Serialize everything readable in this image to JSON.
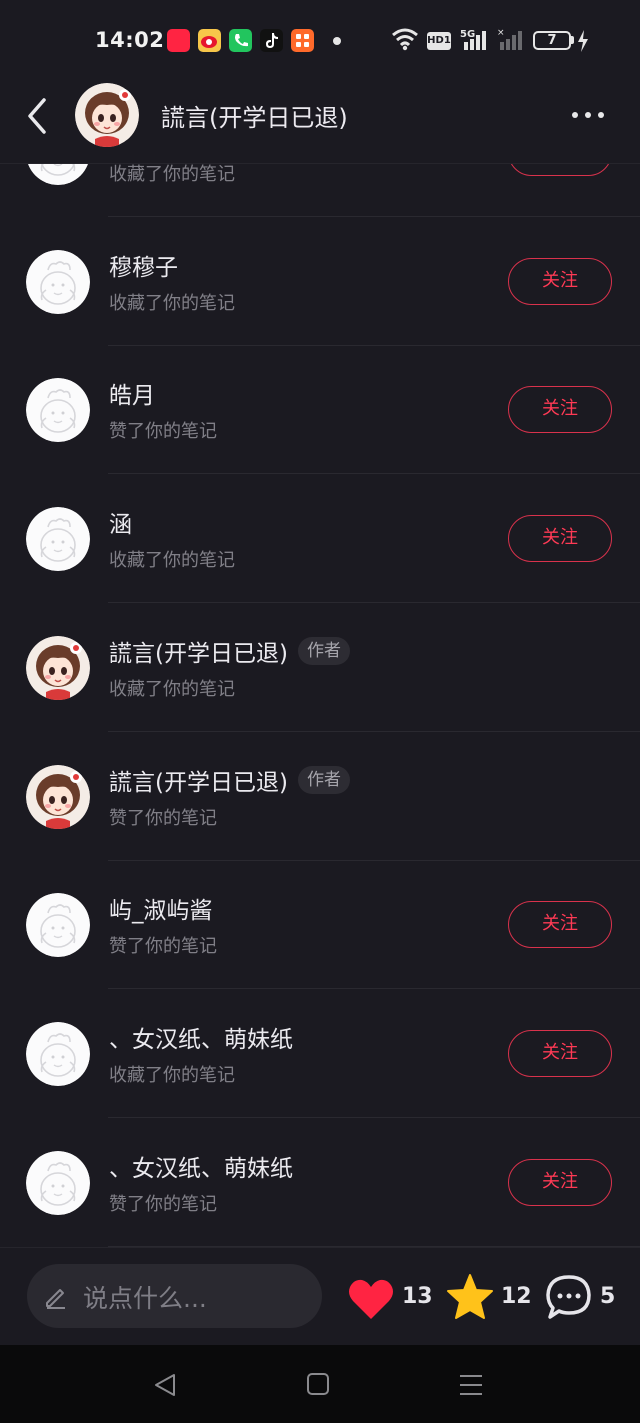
{
  "status_bar": {
    "time": "14:02",
    "hd_label": "HD1",
    "network": "5G",
    "battery": "7"
  },
  "header": {
    "title": "謊言(开学日已退)"
  },
  "notifications": [
    {
      "partial": true,
      "action": "收藏了你的笔记",
      "avatar": "default",
      "follow": true
    },
    {
      "name": "穆穆子",
      "action": "收藏了你的笔记",
      "avatar": "default",
      "follow": true,
      "follow_label": "关注"
    },
    {
      "name": "皓月",
      "action": "赞了你的笔记",
      "avatar": "default",
      "follow": true,
      "follow_label": "关注"
    },
    {
      "name": "涵",
      "action": "收藏了你的笔记",
      "avatar": "default",
      "follow": true,
      "follow_label": "关注"
    },
    {
      "name": "謊言(开学日已退)",
      "action": "收藏了你的笔记",
      "avatar": "author",
      "follow": false,
      "tag": "作者"
    },
    {
      "name": "謊言(开学日已退)",
      "action": "赞了你的笔记",
      "avatar": "author",
      "follow": false,
      "tag": "作者"
    },
    {
      "name": "屿_淑屿酱",
      "action": "赞了你的笔记",
      "avatar": "default",
      "follow": true,
      "follow_label": "关注"
    },
    {
      "name": "、女汉纸、萌妹纸",
      "action": "收藏了你的笔记",
      "avatar": "default",
      "follow": true,
      "follow_label": "关注"
    },
    {
      "name": "、女汉纸、萌妹纸",
      "action": "赞了你的笔记",
      "avatar": "default",
      "follow": true,
      "follow_label": "关注"
    }
  ],
  "bottom_bar": {
    "placeholder": "说点什么...",
    "likes": "13",
    "collects": "12",
    "comments": "5"
  },
  "colors": {
    "background": "#1b1a21",
    "accent": "#ff3a55",
    "like": "#ff2442",
    "star": "#ffc21a"
  }
}
